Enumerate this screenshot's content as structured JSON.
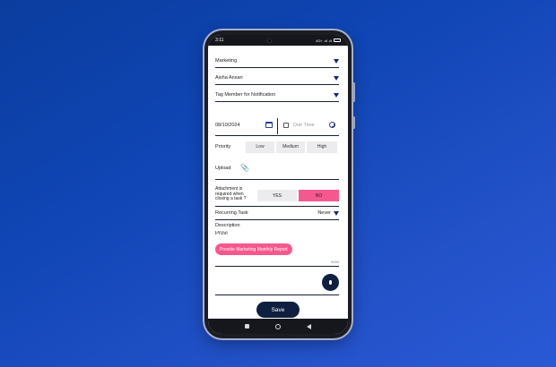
{
  "status_bar": {
    "time": "3:11",
    "network": "4G+ .ıll .ıll"
  },
  "form": {
    "category": "Marketing",
    "assignee": "Aisha Ansari",
    "tag_member_placeholder": "Tag Member for Notification",
    "date": "08/10/2024",
    "due_time_placeholder": "Due Time",
    "priority_label": "Priority",
    "priority_options": [
      "Low",
      "Medium",
      "High"
    ],
    "upload_label": "Upload",
    "attachment_label": "Attachment is required when closing a task ?",
    "attachment_yes": "YES",
    "attachment_no": "NO",
    "attachment_selected": "NO",
    "recurring_label": "Recurring Task",
    "recurring_value": "Never",
    "description_label": "Description",
    "description_value": "Provi",
    "suggestion_chip": "Provide Marketing Monthly Report",
    "char_counter": "5/200",
    "save_label": "Save"
  },
  "colors": {
    "accent_pink": "#f5588e",
    "navy": "#0e1f3f",
    "bg_blue": "#0f45b4"
  },
  "icons": [
    "calendar-icon",
    "clock-icon",
    "paperclip-icon",
    "mic-icon",
    "dropdown-triangle-icon"
  ]
}
